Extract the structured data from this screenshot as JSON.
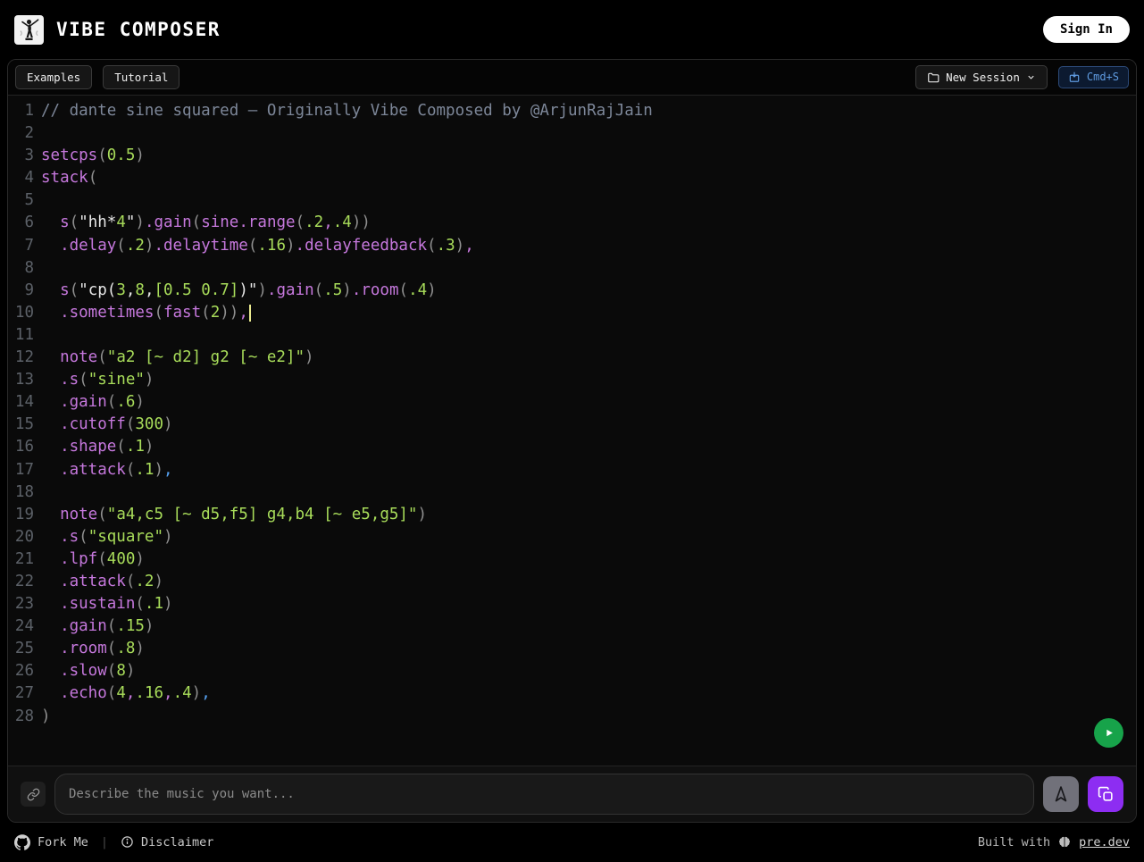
{
  "header": {
    "title": "VIBE COMPOSER",
    "sign_in": "Sign In"
  },
  "toolbar": {
    "examples": "Examples",
    "tutorial": "Tutorial",
    "new_session": "New Session",
    "save_shortcut": "Cmd+S"
  },
  "editor": {
    "lines": [
      {
        "n": 1,
        "t": [
          [
            "cm",
            "// dante sine squared – Originally Vibe Composed by @ArjunRajJain"
          ]
        ]
      },
      {
        "n": 2,
        "t": []
      },
      {
        "n": 3,
        "t": [
          [
            "fn",
            "setcps"
          ],
          [
            "pr",
            "("
          ],
          [
            "nm",
            "0.5"
          ],
          [
            "pr",
            ")"
          ]
        ]
      },
      {
        "n": 4,
        "t": [
          [
            "fn",
            "stack"
          ],
          [
            "pr",
            "("
          ]
        ]
      },
      {
        "n": 5,
        "t": []
      },
      {
        "n": 6,
        "t": [
          [
            "pl",
            "  "
          ],
          [
            "fn",
            "s"
          ],
          [
            "pr",
            "("
          ],
          [
            "st",
            "\"hh*"
          ],
          [
            "nm",
            "4"
          ],
          [
            "st",
            "\""
          ],
          [
            "pr",
            ")"
          ],
          [
            "fn",
            ".gain"
          ],
          [
            "pr",
            "("
          ],
          [
            "fn",
            "sine.range"
          ],
          [
            "pr",
            "("
          ],
          [
            "nm",
            ".2"
          ],
          [
            "fn",
            ","
          ],
          [
            "nm",
            ".4"
          ],
          [
            "pr",
            "))"
          ]
        ]
      },
      {
        "n": 7,
        "t": [
          [
            "pl",
            "  "
          ],
          [
            "fn",
            ".delay"
          ],
          [
            "pr",
            "("
          ],
          [
            "nm",
            ".2"
          ],
          [
            "pr",
            ")"
          ],
          [
            "fn",
            ".delaytime"
          ],
          [
            "pr",
            "("
          ],
          [
            "nm",
            ".16"
          ],
          [
            "pr",
            ")"
          ],
          [
            "fn",
            ".delayfeedback"
          ],
          [
            "pr",
            "("
          ],
          [
            "nm",
            ".3"
          ],
          [
            "pr",
            ")"
          ],
          [
            "fn",
            ","
          ]
        ]
      },
      {
        "n": 8,
        "t": []
      },
      {
        "n": 9,
        "t": [
          [
            "pl",
            "  "
          ],
          [
            "fn",
            "s"
          ],
          [
            "pr",
            "("
          ],
          [
            "st",
            "\"cp("
          ],
          [
            "nm",
            "3"
          ],
          [
            "st",
            ","
          ],
          [
            "nm",
            "8"
          ],
          [
            "st",
            ","
          ],
          [
            "nm",
            "[0.5 0.7]"
          ],
          [
            "st",
            ")\""
          ],
          [
            "pr",
            ")"
          ],
          [
            "fn",
            ".gain"
          ],
          [
            "pr",
            "("
          ],
          [
            "nm",
            ".5"
          ],
          [
            "pr",
            ")"
          ],
          [
            "fn",
            ".room"
          ],
          [
            "pr",
            "("
          ],
          [
            "nm",
            ".4"
          ],
          [
            "pr",
            ")"
          ]
        ]
      },
      {
        "n": 10,
        "t": [
          [
            "pl",
            "  "
          ],
          [
            "fn",
            ".sometimes"
          ],
          [
            "pr",
            "("
          ],
          [
            "fn",
            "fast"
          ],
          [
            "pr",
            "("
          ],
          [
            "nm",
            "2"
          ],
          [
            "pr",
            "))"
          ],
          [
            "fn",
            ","
          ],
          [
            "cur",
            ""
          ]
        ]
      },
      {
        "n": 11,
        "t": []
      },
      {
        "n": 12,
        "t": [
          [
            "pl",
            "  "
          ],
          [
            "fn",
            "note"
          ],
          [
            "pr",
            "("
          ],
          [
            "nm",
            "\"a2 [~ d2] g2 [~ e2]\""
          ],
          [
            "pr",
            ")"
          ]
        ]
      },
      {
        "n": 13,
        "t": [
          [
            "pl",
            "  "
          ],
          [
            "fn",
            ".s"
          ],
          [
            "pr",
            "("
          ],
          [
            "nm",
            "\"sine\""
          ],
          [
            "pr",
            ")"
          ]
        ]
      },
      {
        "n": 14,
        "t": [
          [
            "pl",
            "  "
          ],
          [
            "fn",
            ".gain"
          ],
          [
            "pr",
            "("
          ],
          [
            "nm",
            ".6"
          ],
          [
            "pr",
            ")"
          ]
        ]
      },
      {
        "n": 15,
        "t": [
          [
            "pl",
            "  "
          ],
          [
            "fn",
            ".cutoff"
          ],
          [
            "pr",
            "("
          ],
          [
            "nm",
            "300"
          ],
          [
            "pr",
            ")"
          ]
        ]
      },
      {
        "n": 16,
        "t": [
          [
            "pl",
            "  "
          ],
          [
            "fn",
            ".shape"
          ],
          [
            "pr",
            "("
          ],
          [
            "nm",
            ".1"
          ],
          [
            "pr",
            ")"
          ]
        ]
      },
      {
        "n": 17,
        "t": [
          [
            "pl",
            "  "
          ],
          [
            "fn",
            ".attack"
          ],
          [
            "pr",
            "("
          ],
          [
            "nm",
            ".1"
          ],
          [
            "pr",
            ")"
          ],
          [
            "bl",
            ","
          ]
        ]
      },
      {
        "n": 18,
        "t": []
      },
      {
        "n": 19,
        "t": [
          [
            "pl",
            "  "
          ],
          [
            "fn",
            "note"
          ],
          [
            "pr",
            "("
          ],
          [
            "nm",
            "\"a4,c5 [~ d5,f5] g4,b4 [~ e5,g5]\""
          ],
          [
            "pr",
            ")"
          ]
        ]
      },
      {
        "n": 20,
        "t": [
          [
            "pl",
            "  "
          ],
          [
            "fn",
            ".s"
          ],
          [
            "pr",
            "("
          ],
          [
            "nm",
            "\"square\""
          ],
          [
            "pr",
            ")"
          ]
        ]
      },
      {
        "n": 21,
        "t": [
          [
            "pl",
            "  "
          ],
          [
            "fn",
            ".lpf"
          ],
          [
            "pr",
            "("
          ],
          [
            "nm",
            "400"
          ],
          [
            "pr",
            ")"
          ]
        ]
      },
      {
        "n": 22,
        "t": [
          [
            "pl",
            "  "
          ],
          [
            "fn",
            ".attack"
          ],
          [
            "pr",
            "("
          ],
          [
            "nm",
            ".2"
          ],
          [
            "pr",
            ")"
          ]
        ]
      },
      {
        "n": 23,
        "t": [
          [
            "pl",
            "  "
          ],
          [
            "fn",
            ".sustain"
          ],
          [
            "pr",
            "("
          ],
          [
            "nm",
            ".1"
          ],
          [
            "pr",
            ")"
          ]
        ]
      },
      {
        "n": 24,
        "t": [
          [
            "pl",
            "  "
          ],
          [
            "fn",
            ".gain"
          ],
          [
            "pr",
            "("
          ],
          [
            "nm",
            ".15"
          ],
          [
            "pr",
            ")"
          ]
        ]
      },
      {
        "n": 25,
        "t": [
          [
            "pl",
            "  "
          ],
          [
            "fn",
            ".room"
          ],
          [
            "pr",
            "("
          ],
          [
            "nm",
            ".8"
          ],
          [
            "pr",
            ")"
          ]
        ]
      },
      {
        "n": 26,
        "t": [
          [
            "pl",
            "  "
          ],
          [
            "fn",
            ".slow"
          ],
          [
            "pr",
            "("
          ],
          [
            "nm",
            "8"
          ],
          [
            "pr",
            ")"
          ]
        ]
      },
      {
        "n": 27,
        "t": [
          [
            "pl",
            "  "
          ],
          [
            "fn",
            ".echo"
          ],
          [
            "pr",
            "("
          ],
          [
            "nm",
            "4"
          ],
          [
            "fn",
            ","
          ],
          [
            "nm",
            ".16"
          ],
          [
            "fn",
            ","
          ],
          [
            "nm",
            ".4"
          ],
          [
            "pr",
            ")"
          ],
          [
            "bl",
            ","
          ]
        ]
      },
      {
        "n": 28,
        "t": [
          [
            "pr",
            ")"
          ]
        ]
      }
    ]
  },
  "prompt": {
    "placeholder": "Describe the music you want...",
    "value": ""
  },
  "footer": {
    "fork": "Fork Me",
    "divider": "|",
    "disclaimer": "Disclaimer",
    "built_with": "Built with",
    "brand_link": "pre.dev"
  },
  "icons": {
    "logo": "conductor-figure",
    "new_session": "folder",
    "new_session_caret": "chevron-down",
    "save": "download-save",
    "play": "play-triangle",
    "attach": "link-chain",
    "send": "navigation-arrow-up",
    "generate": "cards",
    "github": "github-octocat",
    "info": "info-circle",
    "builder": "brain"
  },
  "colors": {
    "play_green": "#17a34a",
    "accent_purple": "#8d2df2",
    "save_blue": "#5f9be0",
    "syntax_function": "#c678dd",
    "syntax_number_string_green": "#a8dc5a",
    "syntax_string_white": "#e8e8e8",
    "syntax_comment": "#7d8799",
    "syntax_punct": "#8f8f8f",
    "syntax_comma_blue": "#55a0f0",
    "cursor_yellow": "#e9e98e"
  }
}
